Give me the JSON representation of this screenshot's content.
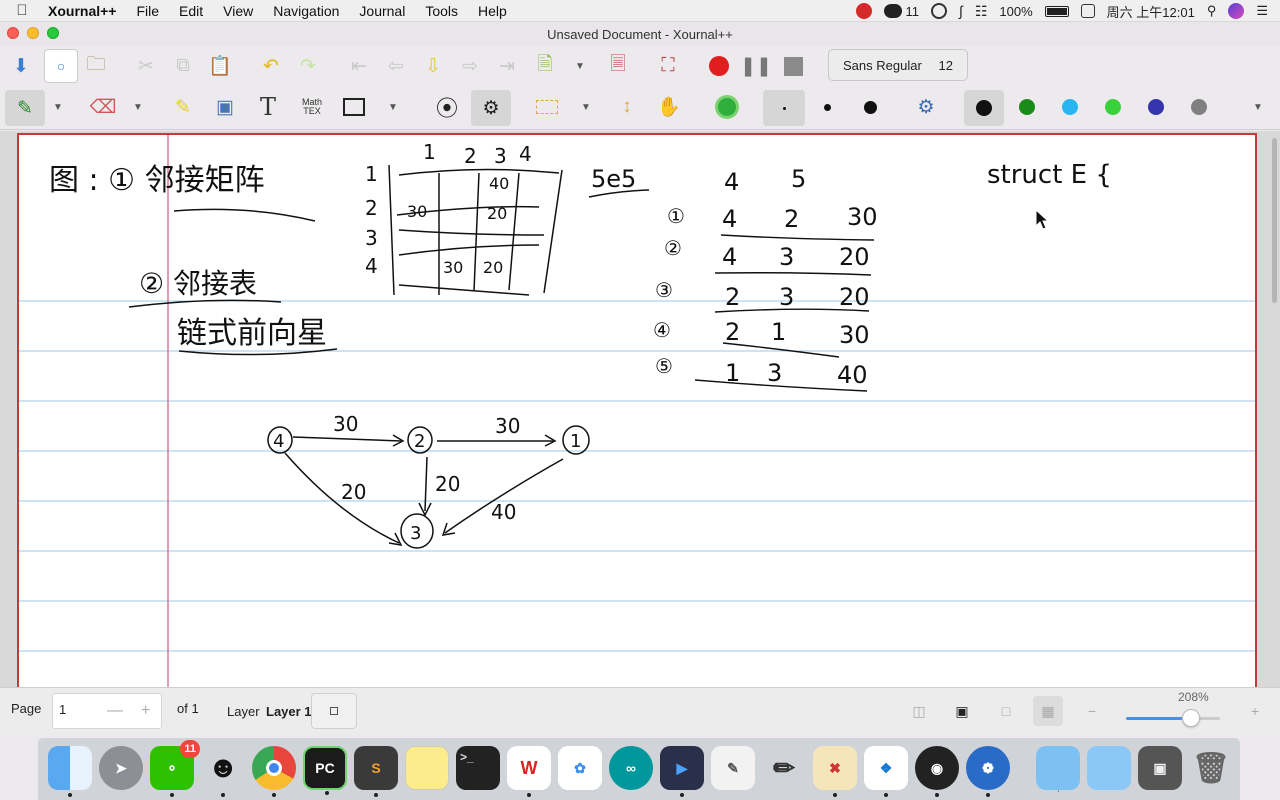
{
  "menubar": {
    "app": "Xournal++",
    "items": [
      "File",
      "Edit",
      "View",
      "Navigation",
      "Journal",
      "Tools",
      "Help"
    ],
    "wechat_count": "11",
    "battery": "100%",
    "clock": "周六 上午12:01"
  },
  "window": {
    "title": "Unsaved Document - Xournal++"
  },
  "toolbar": {
    "font_name": "Sans Regular",
    "font_size": "12",
    "tex_label_top": "Math",
    "tex_label_bottom": "TEX",
    "colors": [
      "#111111",
      "#1a8a1a",
      "#29b6f0",
      "#3ad23a",
      "#3535b0",
      "#808080"
    ]
  },
  "canvas": {
    "notes": {
      "graph_heading": "图 : ① 邻接矩阵",
      "list_heading": "② 邻接表",
      "forward_star": "链式前向星",
      "matrix_col_labels": [
        "1",
        "2",
        "3",
        "4"
      ],
      "matrix_row_labels": [
        "1",
        "2",
        "3",
        "4"
      ],
      "matrix_cells": [
        {
          "row": 1,
          "col": 4,
          "value": "40"
        },
        {
          "row": 2,
          "col": 1,
          "value": "30"
        },
        {
          "row": 2,
          "col": 4,
          "value": "20"
        },
        {
          "row": 4,
          "col": 2,
          "value": "30"
        },
        {
          "row": 4,
          "col": 3,
          "value": "20"
        }
      ],
      "ses_label": "5e5",
      "edge_header": [
        "4",
        "5"
      ],
      "edge_list": [
        {
          "idx": "①",
          "from": "4",
          "to": "2",
          "w": "30"
        },
        {
          "idx": "②",
          "from": "4",
          "to": "3",
          "w": "20"
        },
        {
          "idx": "③",
          "from": "2",
          "to": "3",
          "w": "20"
        },
        {
          "idx": "④",
          "from": "2",
          "to": "1",
          "w": "30"
        },
        {
          "idx": "⑤",
          "from": "1",
          "to": "3",
          "w": "40"
        }
      ],
      "struct_label": "struct E {",
      "graph_nodes": [
        "4",
        "2",
        "1",
        "3"
      ],
      "graph_edge_weights": [
        "30",
        "30",
        "20",
        "20",
        "40"
      ]
    }
  },
  "statusbar": {
    "page_label": "Page",
    "page_value": "1",
    "minus": "—",
    "plus": "+",
    "of_label": "of 1",
    "layer_label": "Layer",
    "layer_value": "Layer 1",
    "zoom": "208%",
    "zoom_fraction": 0.6
  },
  "dock": {
    "apps": [
      "Finder",
      "Launchpad",
      "WeChat",
      "QQ",
      "Chrome",
      "PyCharm",
      "Sublime Text",
      "Notes",
      "Terminal",
      "WPS",
      "Baidu Netdisk",
      "Arduino",
      "Video",
      "TextEdit",
      "Pencil",
      "Tools",
      "Sticky",
      "OBS",
      "Xournal++",
      "Folder",
      "Folder",
      "Screen",
      "Trash"
    ],
    "wechat_badge": "11"
  }
}
